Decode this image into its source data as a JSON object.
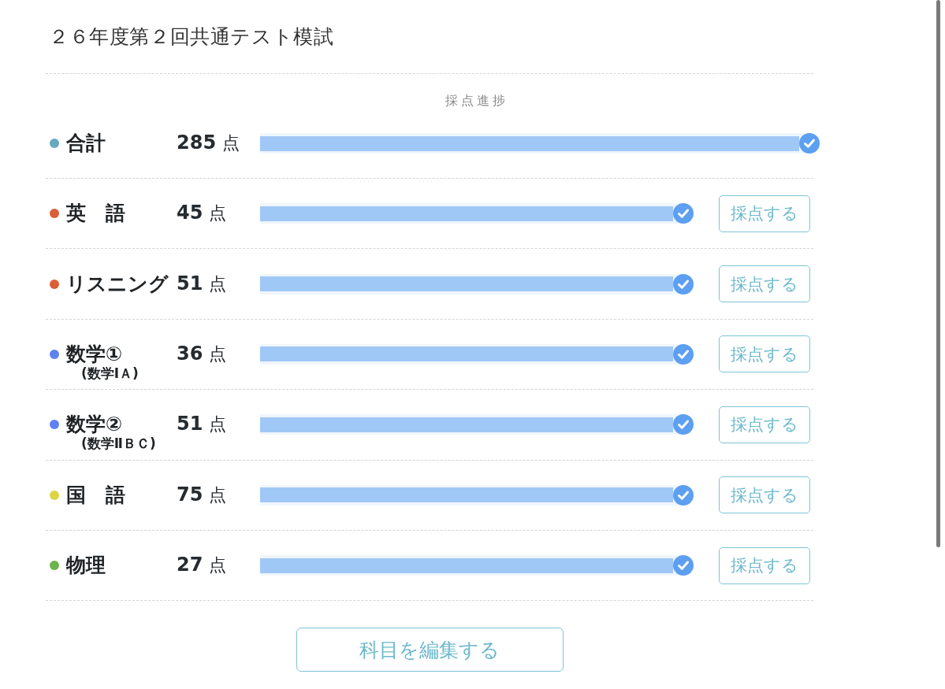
{
  "title": "２６年度第２回共通テスト模試",
  "progress_header": "採点進捗",
  "rows": [
    {
      "kind": "total",
      "name": "合計",
      "color": "#67a9bf",
      "score": "285",
      "unit": "点",
      "level": 1,
      "completed": true
    },
    {
      "kind": "subject",
      "name": "英　語",
      "color": "#d95f37",
      "score": "45",
      "unit": "点",
      "level": 1,
      "completed": true,
      "button": "採点する"
    },
    {
      "kind": "subject",
      "name": "リスニング",
      "color": "#d95f37",
      "score": "51",
      "unit": "点",
      "level": 1,
      "completed": true,
      "button": "採点する"
    },
    {
      "kind": "subject",
      "name": "数学①",
      "note": "(数学ⅠＡ)",
      "color": "#5e82f2",
      "score": "36",
      "unit": "点",
      "level": 1,
      "completed": true,
      "button": "採点する"
    },
    {
      "kind": "subject",
      "name": "数学②",
      "note": "(数学ⅡＢＣ)",
      "color": "#5e82f2",
      "score": "51",
      "unit": "点",
      "level": 1,
      "completed": true,
      "button": "採点する"
    },
    {
      "kind": "subject",
      "name": "国　語",
      "color": "#dcd548",
      "score": "75",
      "unit": "点",
      "level": 1,
      "completed": true,
      "button": "採点する"
    },
    {
      "kind": "subject",
      "name": "物理",
      "color": "#6db34b",
      "score": "27",
      "unit": "点",
      "level": 1,
      "completed": true,
      "button": "採点する"
    }
  ],
  "edit_button": "科目を編集する"
}
